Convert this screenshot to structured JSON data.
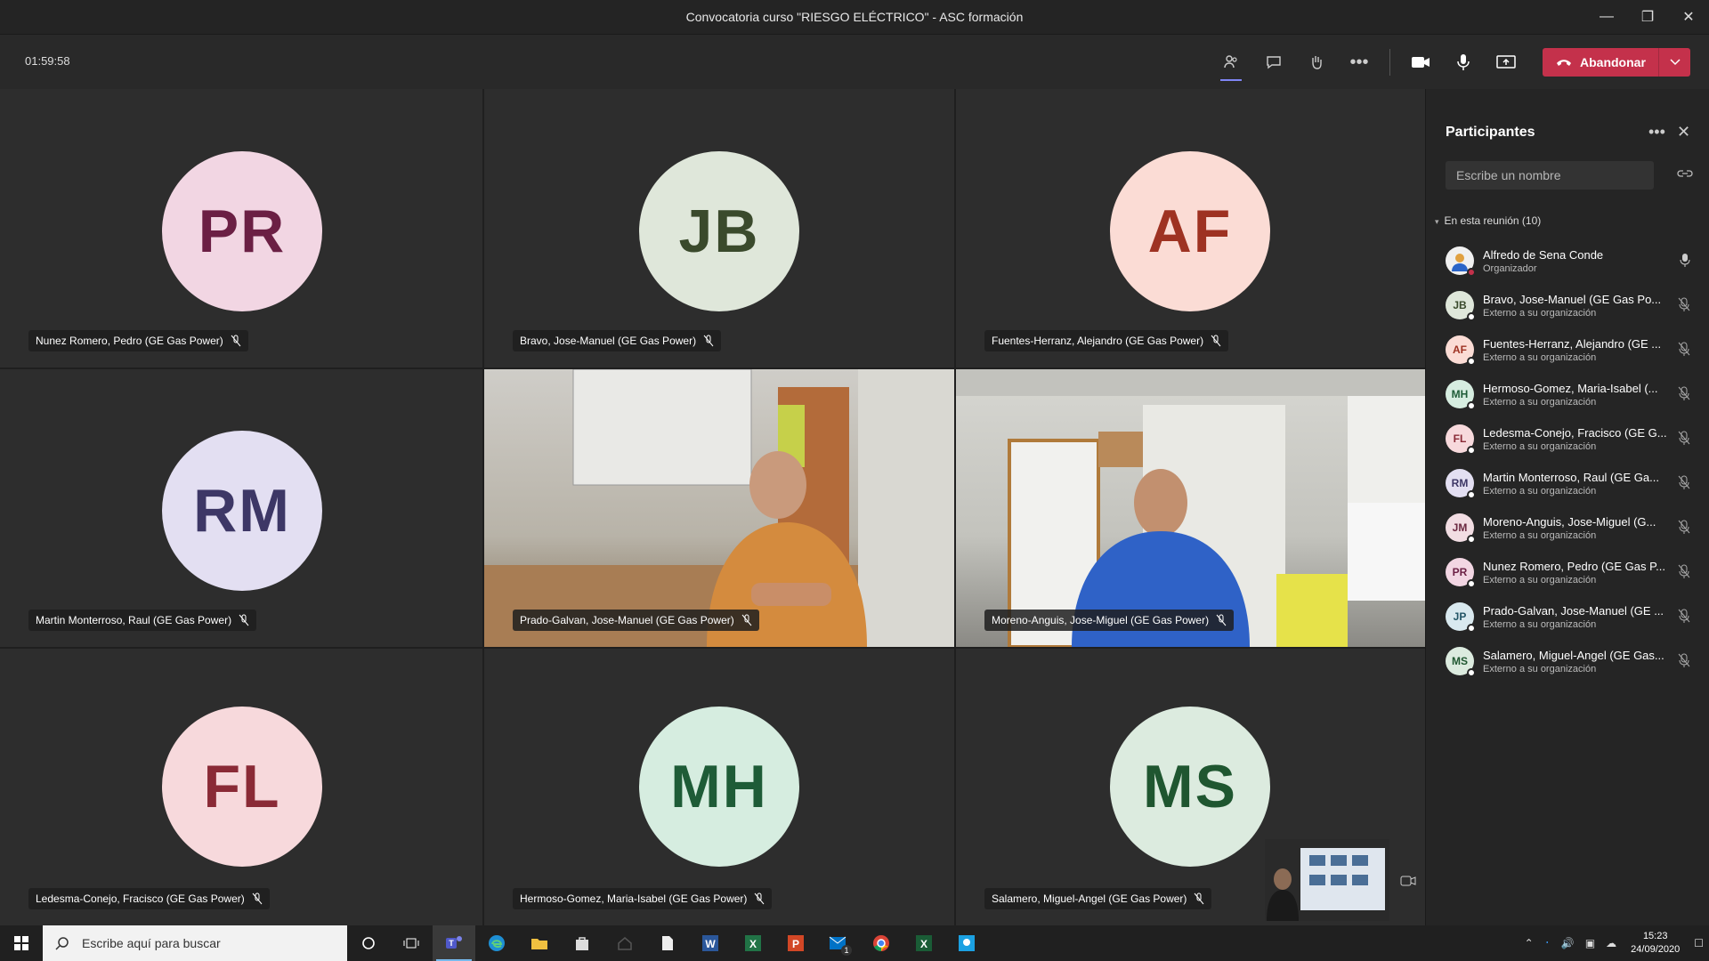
{
  "window": {
    "title": "Convocatoria curso \"RIESGO ELÉCTRICO\" - ASC formación"
  },
  "meeting": {
    "timer": "01:59:58",
    "leave_label": "Abandonar"
  },
  "tiles": [
    {
      "initials": "PR",
      "name": "Nunez Romero, Pedro (GE Gas Power)",
      "bg": "#f2d6e3",
      "fg": "#6b1f44"
    },
    {
      "initials": "JB",
      "name": "Bravo, Jose-Manuel (GE Gas Power)",
      "bg": "#dfe7da",
      "fg": "#3a4a2c"
    },
    {
      "initials": "AF",
      "name": "Fuentes-Herranz, Alejandro (GE Gas Power)",
      "bg": "#fbdcd5",
      "fg": "#9e3222"
    },
    {
      "initials": "RM",
      "name": "Martin Monterroso, Raul (GE Gas Power)",
      "bg": "#e3dff2",
      "fg": "#3d3766"
    },
    {
      "initials": "",
      "name": "Prado-Galvan, Jose-Manuel (GE Gas Power)",
      "bg": "",
      "fg": ""
    },
    {
      "initials": "",
      "name": "Moreno-Anguis, Jose-Miguel (GE Gas Power)",
      "bg": "",
      "fg": ""
    },
    {
      "initials": "FL",
      "name": "Ledesma-Conejo, Fracisco (GE Gas Power)",
      "bg": "#f7d9dc",
      "fg": "#8a2a36"
    },
    {
      "initials": "MH",
      "name": "Hermoso-Gomez, Maria-Isabel (GE Gas Power)",
      "bg": "#d6ede0",
      "fg": "#1e5c37"
    },
    {
      "initials": "MS",
      "name": "Salamero, Miguel-Angel (GE Gas Power)",
      "bg": "#dcebdf",
      "fg": "#1f5630"
    }
  ],
  "panel": {
    "title": "Participantes",
    "search_placeholder": "Escribe un nombre",
    "section": "En esta reunión (10)",
    "participants": [
      {
        "initials": "",
        "name": "Alfredo de Sena Conde",
        "sub": "Organizador",
        "bg": "#f0f0f0",
        "fg": "#333"
      },
      {
        "initials": "JB",
        "name": "Bravo, Jose-Manuel (GE Gas Po...",
        "sub": "Externo a su organización",
        "bg": "#dfe7da",
        "fg": "#3a4a2c"
      },
      {
        "initials": "AF",
        "name": "Fuentes-Herranz, Alejandro (GE ...",
        "sub": "Externo a su organización",
        "bg": "#fbdcd5",
        "fg": "#9e3222"
      },
      {
        "initials": "MH",
        "name": "Hermoso-Gomez, Maria-Isabel (...",
        "sub": "Externo a su organización",
        "bg": "#d6ede0",
        "fg": "#1e5c37"
      },
      {
        "initials": "FL",
        "name": "Ledesma-Conejo, Fracisco (GE G...",
        "sub": "Externo a su organización",
        "bg": "#f7d9dc",
        "fg": "#8a2a36"
      },
      {
        "initials": "RM",
        "name": "Martin Monterroso, Raul (GE Ga...",
        "sub": "Externo a su organización",
        "bg": "#e3dff2",
        "fg": "#3d3766"
      },
      {
        "initials": "JM",
        "name": "Moreno-Anguis, Jose-Miguel (G...",
        "sub": "Externo a su organización",
        "bg": "#f2dde3",
        "fg": "#6b2840"
      },
      {
        "initials": "PR",
        "name": "Nunez Romero, Pedro (GE Gas P...",
        "sub": "Externo a su organización",
        "bg": "#f2d6e3",
        "fg": "#6b1f44"
      },
      {
        "initials": "JP",
        "name": "Prado-Galvan, Jose-Manuel (GE ...",
        "sub": "Externo a su organización",
        "bg": "#d9e9ef",
        "fg": "#235566"
      },
      {
        "initials": "MS",
        "name": "Salamero, Miguel-Angel (GE Gas...",
        "sub": "Externo a su organización",
        "bg": "#dcebdf",
        "fg": "#1f5630"
      }
    ]
  },
  "taskbar": {
    "search_placeholder": "Escribe aquí para buscar",
    "time": "15:23",
    "date": "24/09/2020",
    "mail_badge": "1"
  }
}
